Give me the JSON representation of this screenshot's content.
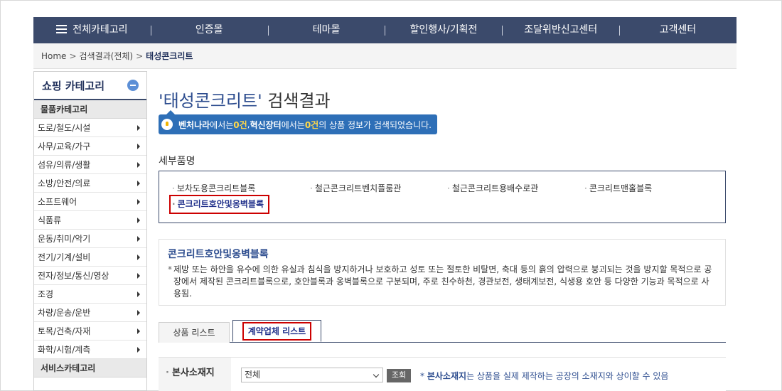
{
  "topnav": {
    "all_category": "전체카테고리",
    "items": [
      "인증몰",
      "테마몰",
      "할인행사/기획전",
      "조달위반신고센터",
      "고객센터"
    ]
  },
  "breadcrumb": {
    "home": "Home",
    "sep": ">",
    "level1": "검색결과(전체)",
    "current": "태성콘크리트"
  },
  "sidebar": {
    "title": "쇼핑 카테고리",
    "group1": "물품카테고리",
    "items": [
      "도로/철도/시설",
      "사무/교육/가구",
      "섬유/의류/생활",
      "소방/안전/의료",
      "소프트웨어",
      "식품류",
      "운동/취미/악기",
      "전기/기계/설비",
      "전자/정보/통신/영상",
      "조경",
      "차량/운송/운반",
      "토목/건축/자재",
      "화학/시험/계측"
    ],
    "group2": "서비스카테고리"
  },
  "main": {
    "title_keyword": "'태성콘크리트'",
    "title_suffix": " 검색결과",
    "info": {
      "site1": "벤처나라",
      "mid1": "에서는 ",
      "count1": "0건",
      "comma": ", ",
      "site2": "혁신장터",
      "mid2": "에서는 ",
      "count2": "0건",
      "tail": " 의 상품 정보가 검색되었습니다."
    },
    "section_head": "세부품명",
    "subitems": [
      "보차도용콘크리트블록",
      "철근콘크리트벤치플룸관",
      "철근콘크리트용배수로관",
      "콘크리트맨홀블록",
      "콘크리트호안및옹벽블록"
    ],
    "subitem_dot": "·",
    "desc_title": "콘크리트호안및옹벽블록",
    "desc_star": "*",
    "desc_text": "제방 또는 하안을 유수에 의한 유실과 침식을 방지하거나 보호하고 성토 또는 절토한 비탈면, 축대 등의 흙의 압력으로 붕괴되는 것을 방지할 목적으로 공장에서 제작된 콘크리트블록으로, 호안블록과 옹벽블록으로 구분되며, 주로 친수하천, 경관보전, 생태계보전, 식생용 호안 등 다양한 기능과 목적으로 사용됨.",
    "tabs": [
      "상품 리스트",
      "계약업체 리스트"
    ],
    "filter": {
      "label": "본사소재지",
      "dot": "·",
      "select_value": "전체",
      "button": "조회",
      "note_prefix": "* ",
      "note_bold": "본사소재지",
      "note_rest": "는 상품을 실제 제작하는 공장의 소재지와 상이할 수 있음"
    }
  }
}
